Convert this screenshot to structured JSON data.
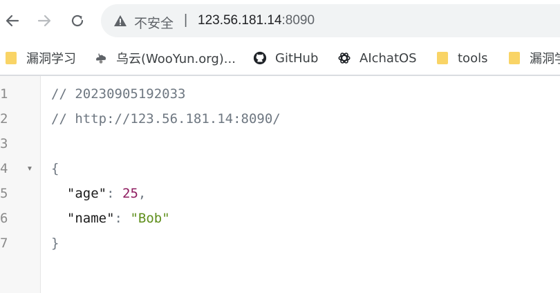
{
  "browser": {
    "security_label": "不安全",
    "separator": "|",
    "url_host": "123.56.181.14",
    "url_port": ":8090"
  },
  "bookmarks": [
    {
      "label": "漏洞学习",
      "icon": "folder-icon"
    },
    {
      "label": "乌云(WooYun.org)...",
      "icon": "wooyun-icon"
    },
    {
      "label": "GitHub",
      "icon": "github-icon"
    },
    {
      "label": "AIchatOS",
      "icon": "openai-icon"
    },
    {
      "label": "tools",
      "icon": "folder-icon"
    },
    {
      "label": "漏洞学",
      "icon": "folder-icon"
    }
  ],
  "code": {
    "line_numbers": [
      "1",
      "2",
      "3",
      "4",
      "5",
      "6",
      "7"
    ],
    "comment1": "// 20230905192033",
    "comment2": "// http://123.56.181.14:8090/",
    "open_brace": "{",
    "key_age": "\"age\"",
    "val_age": "25",
    "key_name": "\"name\"",
    "val_name": "\"Bob\"",
    "close_brace": "}",
    "colon": ":",
    "comma": ","
  },
  "colors": {
    "number": "#8e1b5f",
    "string": "#5f8f1c",
    "comment": "#6e7781",
    "folder": "#f9d466"
  }
}
